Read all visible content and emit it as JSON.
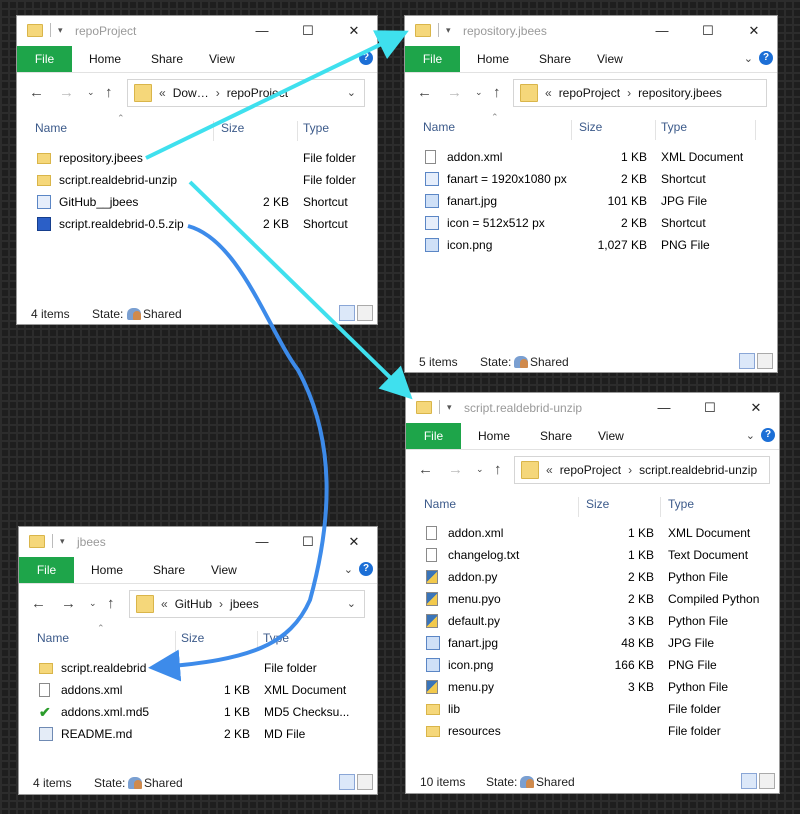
{
  "ribbon": {
    "file": "File",
    "home": "Home",
    "share": "Share",
    "view": "View"
  },
  "windows": {
    "repo": {
      "title": "repoProject",
      "path": [
        "Dow…",
        "repoProject"
      ],
      "headers": {
        "name": "Name",
        "size": "Size",
        "type": "Type"
      },
      "items": [
        {
          "icon": "folder-icon",
          "name": "repository.jbees",
          "size": "",
          "type": "File folder"
        },
        {
          "icon": "folder-icon",
          "name": "script.realdebrid-unzip",
          "size": "",
          "type": "File folder"
        },
        {
          "icon": "shortcut-icon",
          "name": "GitHub__jbees",
          "size": "2 KB",
          "type": "Shortcut"
        },
        {
          "icon": "zip-icon",
          "name": "script.realdebrid-0.5.zip",
          "size": "2 KB",
          "type": "Shortcut"
        }
      ],
      "count": "4 items",
      "state_label": "State:",
      "state_value": "Shared"
    },
    "repository": {
      "title": "repository.jbees",
      "path": [
        "repoProject",
        "repository.jbees"
      ],
      "headers": {
        "name": "Name",
        "size": "Size",
        "type": "Type"
      },
      "items": [
        {
          "icon": "xml-icon",
          "name": "addon.xml",
          "size": "1 KB",
          "type": "XML Document"
        },
        {
          "icon": "shortcut-icon",
          "name": "fanart = 1920x1080 px",
          "size": "2 KB",
          "type": "Shortcut"
        },
        {
          "icon": "image-icon",
          "name": "fanart.jpg",
          "size": "101 KB",
          "type": "JPG File"
        },
        {
          "icon": "shortcut-icon",
          "name": "icon = 512x512 px",
          "size": "2 KB",
          "type": "Shortcut"
        },
        {
          "icon": "image-icon",
          "name": "icon.png",
          "size": "1,027 KB",
          "type": "PNG File"
        }
      ],
      "count": "5 items",
      "state_label": "State:",
      "state_value": "Shared"
    },
    "unzip": {
      "title": "script.realdebrid-unzip",
      "path": [
        "repoProject",
        "script.realdebrid-unzip"
      ],
      "headers": {
        "name": "Name",
        "size": "Size",
        "type": "Type"
      },
      "items": [
        {
          "icon": "xml-icon",
          "name": "addon.xml",
          "size": "1 KB",
          "type": "XML Document"
        },
        {
          "icon": "text-icon",
          "name": "changelog.txt",
          "size": "1 KB",
          "type": "Text Document"
        },
        {
          "icon": "python-icon",
          "name": "addon.py",
          "size": "2 KB",
          "type": "Python File"
        },
        {
          "icon": "python-compiled-icon",
          "name": "menu.pyo",
          "size": "2 KB",
          "type": "Compiled Python"
        },
        {
          "icon": "python-icon",
          "name": "default.py",
          "size": "3 KB",
          "type": "Python File"
        },
        {
          "icon": "image-icon",
          "name": "fanart.jpg",
          "size": "48 KB",
          "type": "JPG File"
        },
        {
          "icon": "image-icon",
          "name": "icon.png",
          "size": "166 KB",
          "type": "PNG File"
        },
        {
          "icon": "python-icon",
          "name": "menu.py",
          "size": "3 KB",
          "type": "Python File"
        },
        {
          "icon": "folder-icon",
          "name": "lib",
          "size": "",
          "type": "File folder"
        },
        {
          "icon": "folder-icon",
          "name": "resources",
          "size": "",
          "type": "File folder"
        }
      ],
      "count": "10 items",
      "state_label": "State:",
      "state_value": "Shared"
    },
    "jbees": {
      "title": "jbees",
      "path": [
        "GitHub",
        "jbees"
      ],
      "headers": {
        "name": "Name",
        "size": "Size",
        "type": "Type"
      },
      "items": [
        {
          "icon": "folder-icon",
          "name": "script.realdebrid",
          "size": "",
          "type": "File folder"
        },
        {
          "icon": "xml-icon",
          "name": "addons.xml",
          "size": "1 KB",
          "type": "XML Document"
        },
        {
          "icon": "checksum-icon",
          "name": "addons.xml.md5",
          "size": "1 KB",
          "type": "MD5 Checksu..."
        },
        {
          "icon": "md-icon",
          "name": "README.md",
          "size": "2 KB",
          "type": "MD File"
        }
      ],
      "count": "4 items",
      "state_label": "State:",
      "state_value": "Shared"
    }
  },
  "colors": {
    "file_tab": "#1ea54a",
    "cyan_arrow": "#3fe0ee",
    "blue_arrow": "#3d8bea"
  }
}
